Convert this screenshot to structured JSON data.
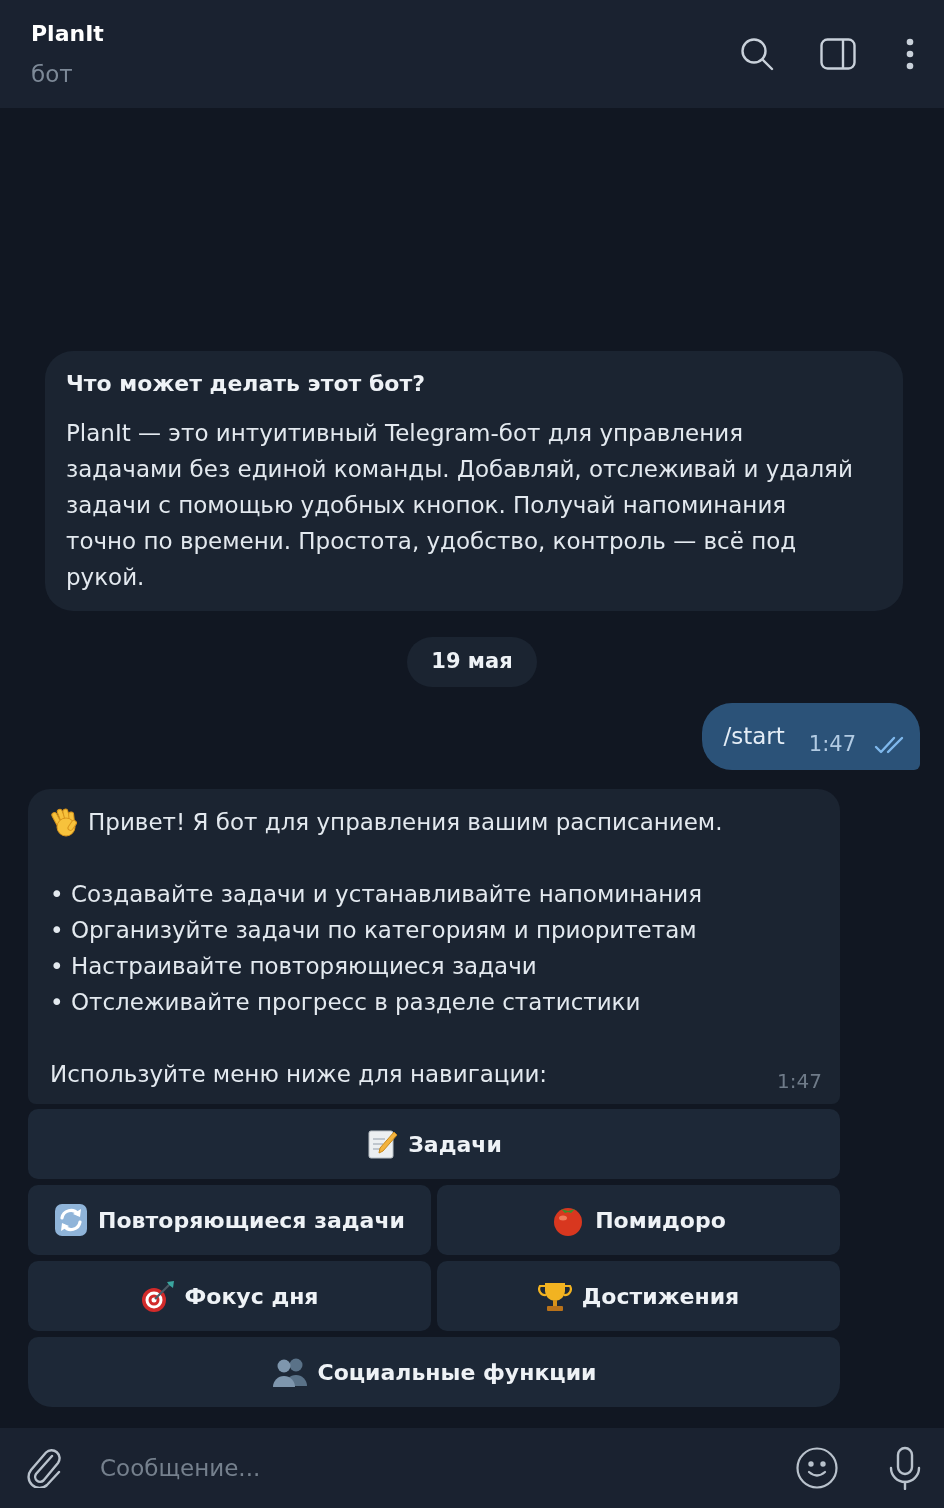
{
  "header": {
    "title": "PlanIt",
    "subtitle": "бот"
  },
  "bot_info": {
    "title": "Что может делать этот бот?",
    "description": "PlanIt — это интуитивный Telegram-бот для управления задачами без единой команды. Добавляй, отслеживай и удаляй задачи с помощью удобных кнопок. Получай напоминания точно по времени. Простота, удобство, контроль — всё под рукой."
  },
  "date_separator": "19 мая",
  "outgoing_message": {
    "text": "/start",
    "time": "1:47",
    "read": true
  },
  "incoming_message": {
    "greeting": "Привет! Я бот для управления вашим расписанием.",
    "bullets": [
      "• Создавайте задачи и устанавливайте напоминания",
      "• Организуйте задачи по категориям и приоритетам",
      "• Настраивайте повторяющиеся задачи",
      "• Отслеживайте прогресс в разделе статистики"
    ],
    "footer": "Используйте меню ниже для навигации:",
    "time": "1:47"
  },
  "keyboard": {
    "rows": [
      [
        "Задачи"
      ],
      [
        "Повторяющиеся задачи",
        "Помидоро"
      ],
      [
        "Фокус дня",
        "Достижения"
      ],
      [
        "Социальные функции"
      ]
    ]
  },
  "composer": {
    "placeholder": "Сообщение..."
  }
}
